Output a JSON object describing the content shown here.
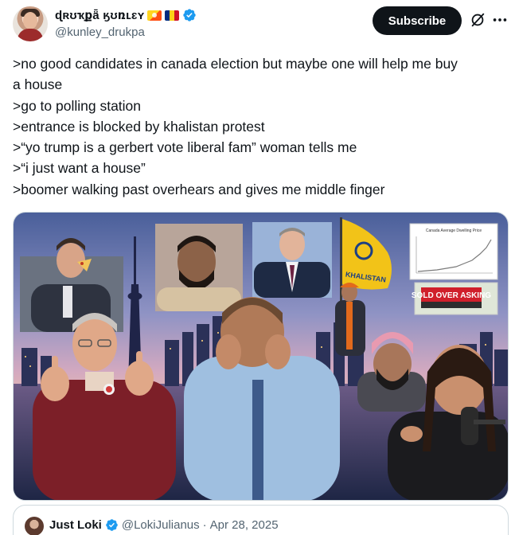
{
  "author": {
    "display_name": "ɖʀʊҡքǟ ӄʊռʟɛʏ",
    "handle": "@kunley_drukpa",
    "badges": [
      "flag-bhutan-icon",
      "flag-romania-icon",
      "verified-badge-icon"
    ],
    "verified_color": "#1d9bf0"
  },
  "header": {
    "subscribe_label": "Subscribe",
    "icons": [
      "grok-icon",
      "more-icon"
    ]
  },
  "tweet": {
    "lines": [
      ">no good candidates in canada election but maybe one will help me buy",
      "a house",
      ">go to polling station",
      ">entrance is blocked by khalistan protest",
      ">“yo trump is a gerbert vote liberal fam” woman tells me",
      ">“i just want a house”",
      ">boomer walking past overhears and gives me middle finger"
    ]
  },
  "media": {
    "chart_title": "Canada Average Dwelling Price",
    "sign_text": "SOLD OVER ASKING",
    "flag_text": "KHALISTAN"
  },
  "quote": {
    "name": "Just Loki",
    "handle": "@LokiJulianus",
    "separator": "·",
    "date": "Apr 28, 2025"
  },
  "colors": {
    "text": "#0f1419",
    "muted": "#536471",
    "button_bg": "#0f1419",
    "border": "#cfd9de"
  }
}
